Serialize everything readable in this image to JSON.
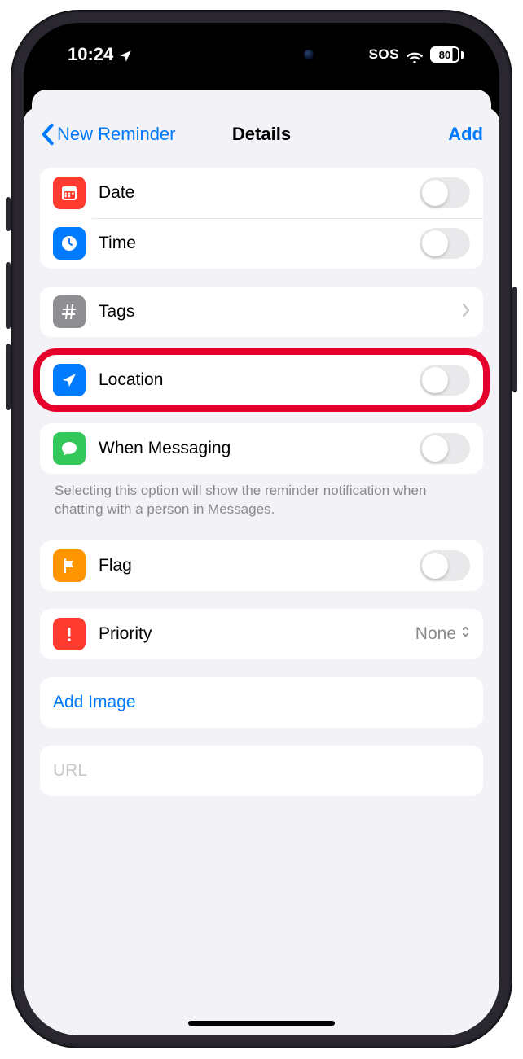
{
  "status": {
    "time": "10:24",
    "sos": "SOS",
    "battery_pct": "80"
  },
  "nav": {
    "back_label": "New Reminder",
    "title": "Details",
    "action": "Add"
  },
  "rows": {
    "date": "Date",
    "time": "Time",
    "tags": "Tags",
    "location": "Location",
    "messaging": "When Messaging",
    "messaging_footer": "Selecting this option will show the reminder notification when chatting with a person in Messages.",
    "flag": "Flag",
    "priority": "Priority",
    "priority_value": "None",
    "add_image": "Add Image",
    "url_placeholder": "URL"
  }
}
